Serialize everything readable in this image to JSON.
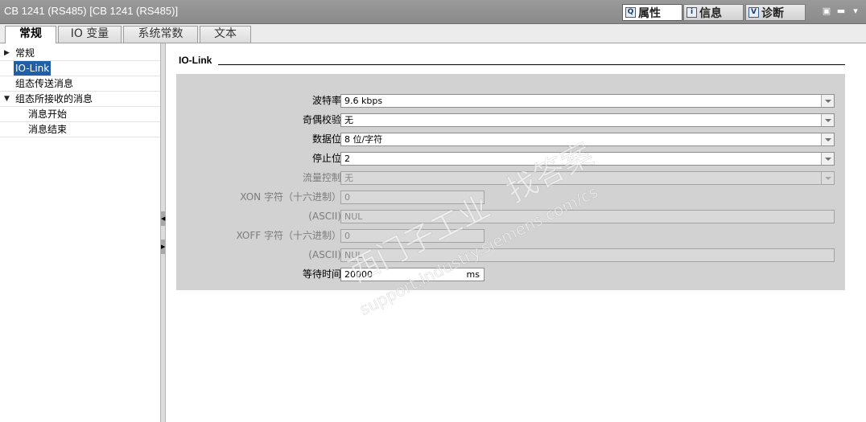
{
  "window": {
    "title": "CB 1241 (RS485) [CB 1241 (RS485)]"
  },
  "inspector_tabs": [
    {
      "label": "属性",
      "icon": "properties-icon",
      "glyph": "Q"
    },
    {
      "label": "信息",
      "icon": "info-icon",
      "glyph": "i"
    },
    {
      "label": "诊断",
      "icon": "diagnostics-icon",
      "glyph": "V"
    }
  ],
  "window_controls": {
    "float": "▣",
    "minimize": "▬",
    "menu": "▾"
  },
  "property_tabs": [
    {
      "label": "常规"
    },
    {
      "label": "IO 变量"
    },
    {
      "label": "系统常数"
    },
    {
      "label": "文本"
    }
  ],
  "nav": {
    "items": [
      {
        "label": "常规",
        "caret": "▶"
      },
      {
        "label": "IO-Link",
        "selected": true
      },
      {
        "label": "组态传送消息"
      },
      {
        "label": "组态所接收的消息",
        "caret": "▼"
      },
      {
        "label": "消息开始"
      },
      {
        "label": "消息结束"
      }
    ]
  },
  "section": {
    "title": "IO-Link"
  },
  "form": {
    "baud_rate": {
      "label": "波特率:",
      "value": "9.6 kbps"
    },
    "parity": {
      "label": "奇偶校验:",
      "value": "无"
    },
    "data_bits": {
      "label": "数据位:",
      "value": "8 位/字符"
    },
    "stop_bits": {
      "label": "停止位:",
      "value": "2"
    },
    "flow_control": {
      "label": "流量控制:",
      "value": "无"
    },
    "xon_hex": {
      "label": "XON 字符（十六进制）:",
      "value": "0"
    },
    "xon_ascii": {
      "label": "(ASCII):",
      "value": "NUL"
    },
    "xoff_hex": {
      "label": "XOFF 字符（十六进制）:",
      "value": "0"
    },
    "xoff_ascii": {
      "label": "(ASCII):",
      "value": "NUL"
    },
    "wait_time": {
      "label": "等待时间:",
      "value": "20000",
      "unit": "ms"
    }
  },
  "watermark": {
    "line1": "西门子工业",
    "line2": "找答案",
    "line3": "support.industry.siemens.com/cs"
  },
  "colors": {
    "selection": "#1f5fa8",
    "panel": "#d2d2d2",
    "titlebar": "#8f8f8f"
  }
}
